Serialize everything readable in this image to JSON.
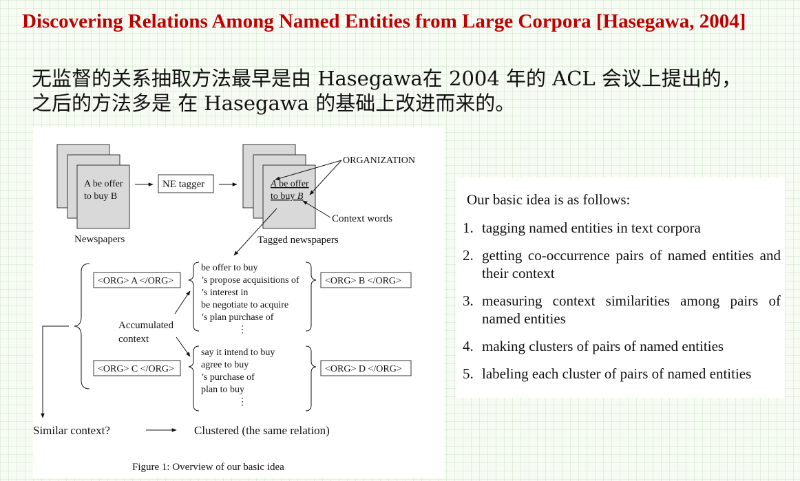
{
  "slide": {
    "title": "Discovering Relations Among Named Entities from Large Corpora [Hasegawa, 2004]",
    "intro_lines": [
      "无监督的关系抽取方法最早是由 Hasegawa在 2004 年的 ACL 会议上提出的，",
      "之后的方法多是 在 Hasegawa 的基础上改进而来的。"
    ]
  },
  "figure": {
    "doc_text_line1": "A be offer",
    "doc_text_line2": "to buy B",
    "newspapers_label": "Newspapers",
    "ne_tagger_label": "NE tagger",
    "tagged_label": "Tagged newspapers",
    "organization_label": "ORGANIZATION",
    "context_words_label": "Context words",
    "tagged_text_line1_a": "A",
    "tagged_text_line1_rest": " be offer",
    "tagged_text_line2_pre": "to buy ",
    "tagged_text_line2_b": "B",
    "org_a_label": "<ORG> A </ORG>",
    "org_b_label": "<ORG> B </ORG>",
    "org_c_label": "<ORG> C </ORG>",
    "org_d_label": "<ORG> D </ORG>",
    "contexts_ab": [
      "be offer to buy",
      "’s propose acquisitions of",
      "’s interest in",
      "be negotiate to acquire",
      "’s plan purchase of",
      "⋮"
    ],
    "contexts_cd": [
      "say it intend to buy",
      "agree to buy",
      "’s purchase of",
      "plan to buy",
      "⋮"
    ],
    "accumulated_line1": "Accumulated",
    "accumulated_line2": "context",
    "similar_context_label": "Similar context?",
    "clustered_label": "Clustered (the same relation)",
    "caption": "Figure 1: Overview of our basic idea"
  },
  "steps": {
    "heading": "Our basic idea is as follows:",
    "items": [
      {
        "num": "1.",
        "text": "tagging named entities in text corpora"
      },
      {
        "num": "2.",
        "text": "getting co-occurrence pairs of named entities and their context"
      },
      {
        "num": "3.",
        "text": "measuring context similarities among pairs of named entities"
      },
      {
        "num": "4.",
        "text": "making clusters of pairs of named entities"
      },
      {
        "num": "5.",
        "text": "labeling each cluster of pairs of named entities"
      }
    ]
  }
}
